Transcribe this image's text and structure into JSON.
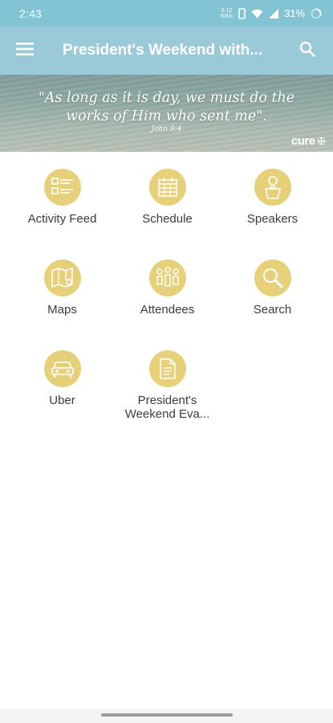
{
  "status_bar": {
    "time": "2:43",
    "net_speed_top": "0.12",
    "net_speed_bottom": "KB/s",
    "battery_percent": "31%"
  },
  "app_bar": {
    "title": "President's Weekend with...",
    "menu_icon": "hamburger-menu-icon",
    "search_icon": "search-icon"
  },
  "banner": {
    "quote": "\"As long as it is day, we must do the works of Him who sent me\".",
    "reference": "John 9:4",
    "logo": "cure"
  },
  "tiles": [
    {
      "label": "Activity Feed",
      "icon": "activity-feed-icon"
    },
    {
      "label": "Schedule",
      "icon": "calendar-icon"
    },
    {
      "label": "Speakers",
      "icon": "speaker-icon"
    },
    {
      "label": "Maps",
      "icon": "map-icon"
    },
    {
      "label": "Attendees",
      "icon": "attendees-icon"
    },
    {
      "label": "Search",
      "icon": "search-icon"
    },
    {
      "label": "Uber",
      "icon": "car-icon"
    },
    {
      "label": "President's Weekend Eva...",
      "icon": "document-icon"
    }
  ],
  "colors": {
    "status_bar": "#83c4d4",
    "app_bar": "#9acad8",
    "tile_icon": "#e6d07a",
    "tile_icon_glyph": "#ffffff"
  }
}
